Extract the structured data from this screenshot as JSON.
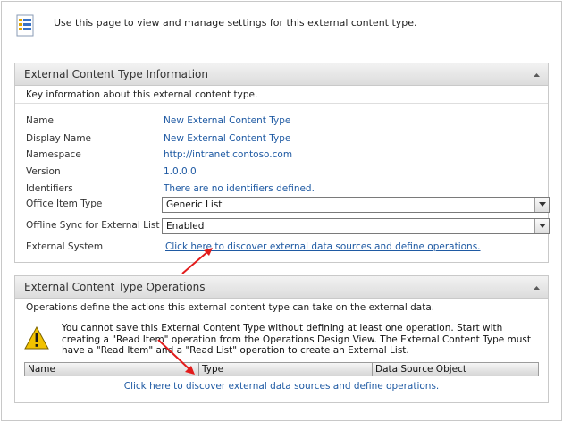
{
  "header": {
    "description": "Use this page to view and manage settings for this external content type.",
    "icon": "page-settings-icon"
  },
  "info_panel": {
    "title": "External Content Type Information",
    "description": "Key information about this external content type.",
    "fields": {
      "name": {
        "label": "Name",
        "value": "New External Content Type"
      },
      "display_name": {
        "label": "Display Name",
        "value": "New External Content Type"
      },
      "namespace": {
        "label": "Namespace",
        "value": "http://intranet.contoso.com"
      },
      "version": {
        "label": "Version",
        "value": "1.0.0.0"
      },
      "identifiers": {
        "label": "Identifiers",
        "value": "There are no identifiers defined."
      },
      "office_item_type": {
        "label": "Office Item Type",
        "value": "Generic List"
      },
      "offline_sync": {
        "label": "Offline Sync for External List",
        "value": "Enabled"
      },
      "external_system": {
        "label": "External System",
        "value": "Click here to discover external data sources and define operations."
      }
    }
  },
  "operations_panel": {
    "title": "External Content Type Operations",
    "description": "Operations define the actions this external content type can take on the external data.",
    "warning": "You cannot save this External Content Type without defining at least one operation. Start with creating a \"Read Item\" operation from the Operations Design View. The External Content Type must have a \"Read Item\" and a \"Read List\" operation to create an External List.",
    "columns": [
      "Name",
      "Type",
      "Data Source Object"
    ],
    "discover_link": "Click here to discover external data sources and define operations."
  },
  "colors": {
    "link": "#1f5aa3",
    "arrow": "#e21b1b",
    "warning": "#f2c200"
  }
}
